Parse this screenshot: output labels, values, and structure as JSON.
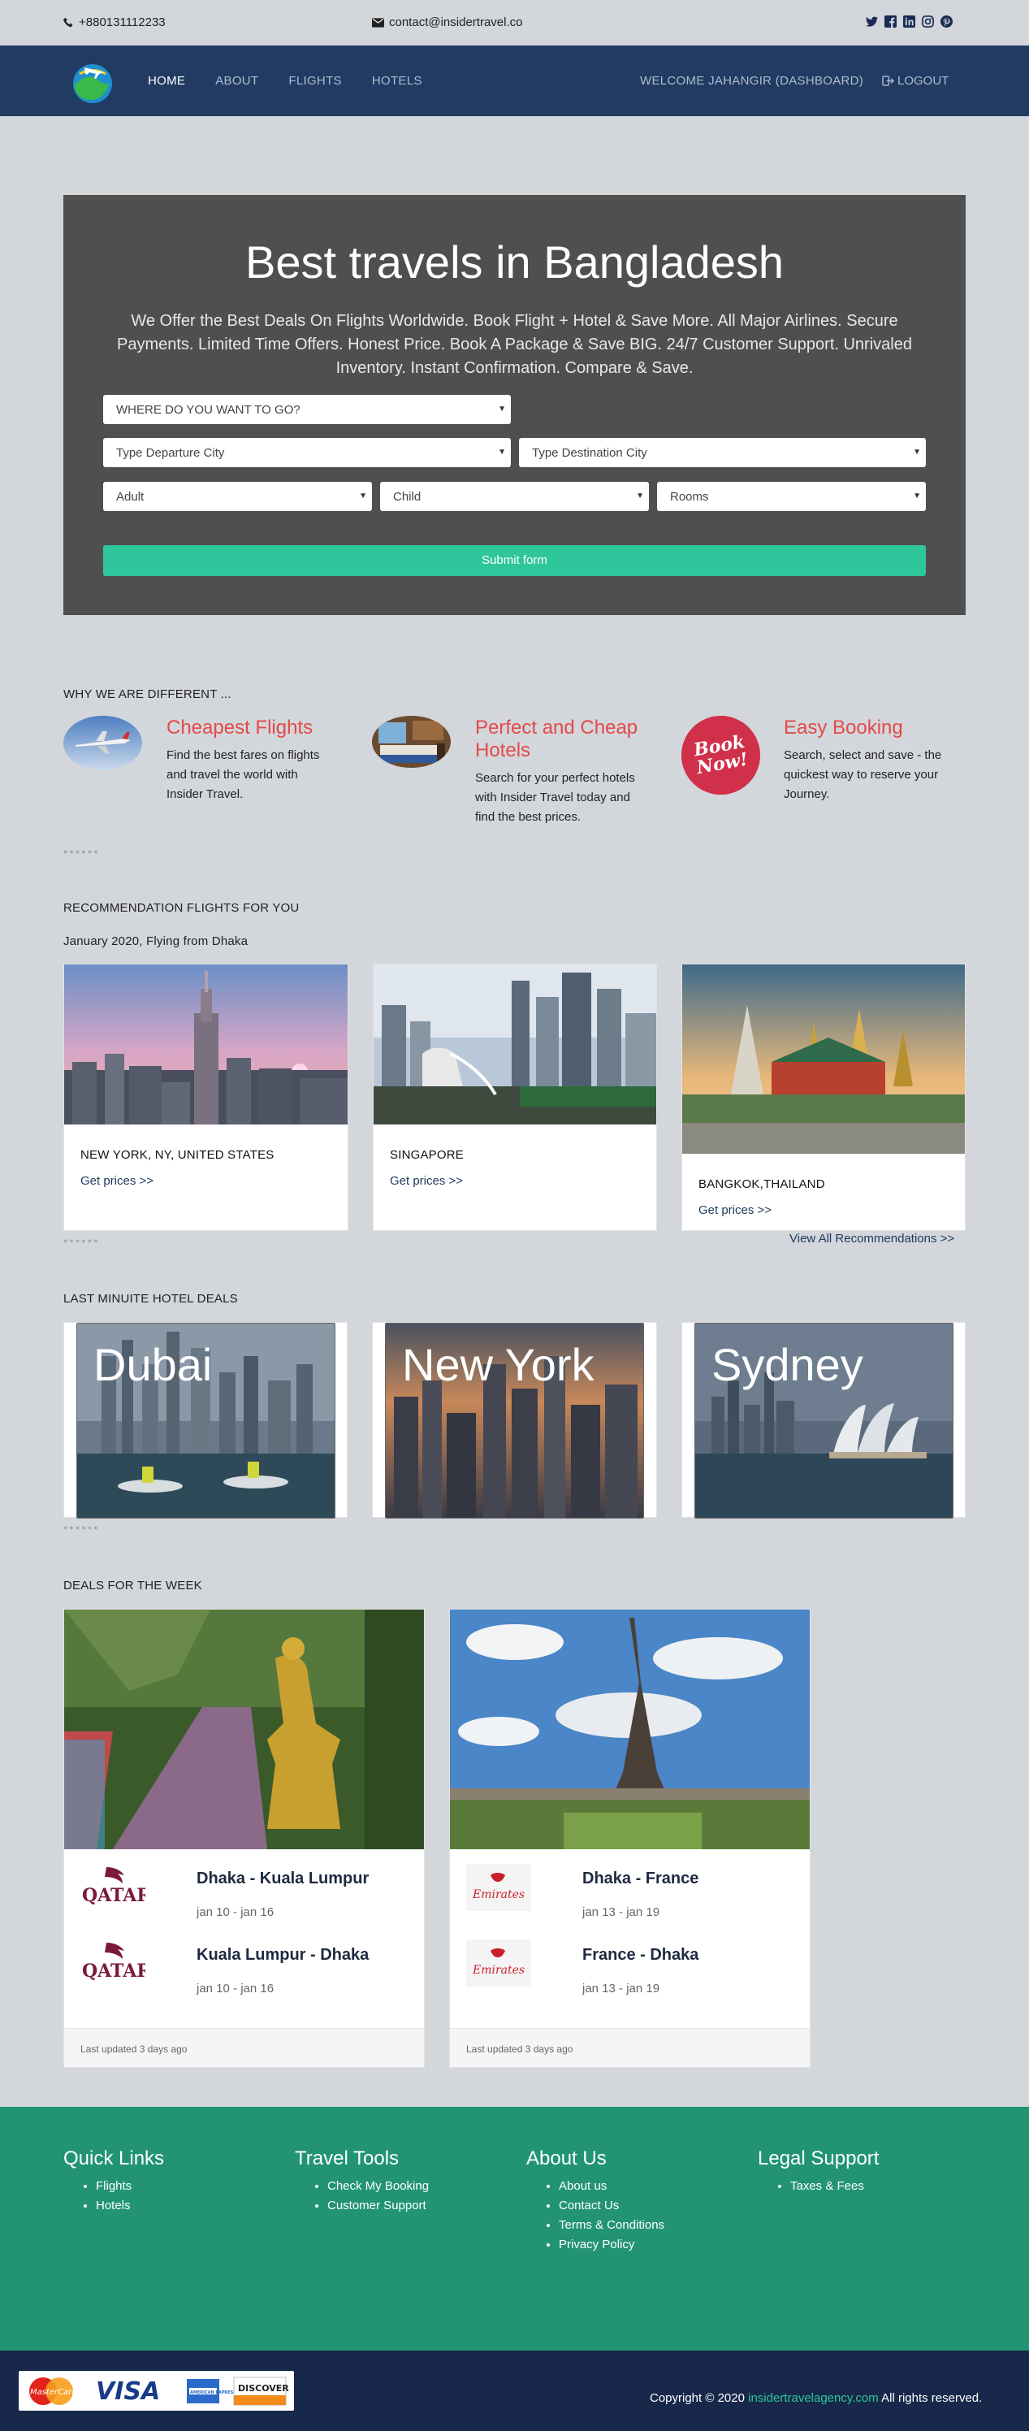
{
  "topbar": {
    "phone": "+880131112233",
    "email": "contact@insidertravel.co",
    "social_icons": [
      "twitter-icon",
      "facebook-icon",
      "linkedin-icon",
      "instagram-icon",
      "pinterest-icon"
    ]
  },
  "nav": {
    "items": [
      "HOME",
      "ABOUT",
      "FLIGHTS",
      "HOTELS"
    ],
    "active": "HOME",
    "welcome": "WELCOME JAHANGIR (DASHBOARD)",
    "logout": "LOGOUT"
  },
  "hero": {
    "title": "Best travels in Bangladesh",
    "text": "We Offer the Best Deals On Flights Worldwide. Book Flight + Hotel & Save More. All Major Airlines. Secure Payments. Limited Time Offers. Honest Price. Book A Package & Save BIG. 24/7 Customer Support. Unrivaled Inventory. Instant Confirmation. Compare & Save.",
    "where_select": "WHERE DO YOU WANT TO GO?",
    "departure_select": "Type Departure City",
    "destination_select": "Type Destination City",
    "adult_select": "Adult",
    "child_select": "Child",
    "rooms_select": "Rooms",
    "submit_label": "Submit form"
  },
  "why": {
    "heading": "WHY WE ARE DIFFERENT ...",
    "features": [
      {
        "title": "Cheapest Flights",
        "text": "Find the best fares on flights and travel the world with Insider Travel."
      },
      {
        "title": "Perfect and Cheap Hotels",
        "text": "Search for your perfect hotels with Insider Travel today and find the best prices."
      },
      {
        "title": "Easy Booking",
        "text": "Search, select and save - the quickest way to reserve your Journey."
      }
    ],
    "book_now_badge": "Book Now!"
  },
  "recommend": {
    "heading": "RECOMMENDATION FLIGHTS FOR YOU",
    "subheading": "January 2020, Flying from Dhaka",
    "cards": [
      {
        "title": "NEW YORK, NY, UNITED STATES",
        "link": "Get prices >>"
      },
      {
        "title": "SINGAPORE",
        "link": "Get prices >>"
      },
      {
        "title": "BANGKOK,THAILAND",
        "link": "Get prices >>"
      }
    ],
    "view_all": "View All Recommendations >>"
  },
  "hotels": {
    "heading": "LAST MINUITE HOTEL DEALS",
    "cities": [
      "Dubai",
      "New York",
      "Sydney"
    ]
  },
  "deals": {
    "heading": "DEALS FOR THE WEEK",
    "cards": [
      {
        "airline": "QATAR",
        "routes": [
          {
            "route": "Dhaka - Kuala Lumpur",
            "date": "jan 10 - jan 16"
          },
          {
            "route": "Kuala Lumpur - Dhaka",
            "date": "jan 10 - jan 16"
          }
        ],
        "updated": "Last updated 3 days ago"
      },
      {
        "airline": "Emirates",
        "routes": [
          {
            "route": "Dhaka - France",
            "date": "jan 13 - jan 19"
          },
          {
            "route": "France - Dhaka",
            "date": "jan 13 - jan 19"
          }
        ],
        "updated": "Last updated 3 days ago"
      }
    ]
  },
  "footer": {
    "columns": [
      {
        "title": "Quick Links",
        "items": [
          "Flights",
          "Hotels"
        ]
      },
      {
        "title": "Travel Tools",
        "items": [
          "Check My Booking",
          "Customer Support"
        ]
      },
      {
        "title": "About Us",
        "items": [
          "About us",
          "Contact Us",
          "Terms & Conditions",
          "Privacy Policy"
        ]
      },
      {
        "title": "Legal Support",
        "items": [
          "Taxes & Fees"
        ]
      }
    ],
    "payment_cards": [
      "MasterCard",
      "VISA",
      "AMERICAN EXPRESS",
      "DISCOVER"
    ],
    "copyright_prefix": "Copyright © 2020",
    "copyright_link": "insidertravelagency.com",
    "copyright_suffix": "All rights reserved."
  },
  "colors": {
    "nav_bg": "#223b62",
    "accent_green": "#2ec69a",
    "feature_red": "#e34a4a",
    "footer_bg": "#229473",
    "bottom_bg": "#17284a"
  }
}
